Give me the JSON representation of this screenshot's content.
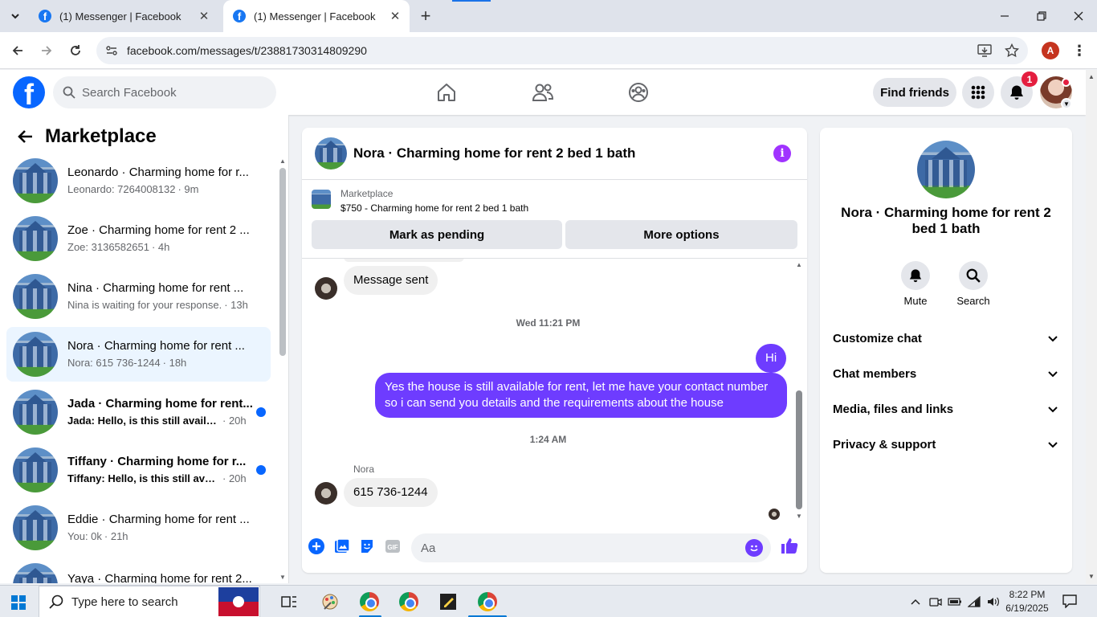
{
  "browser": {
    "tabs": [
      {
        "title": "(1) Messenger | Facebook",
        "active": false
      },
      {
        "title": "(1) Messenger | Facebook",
        "active": true
      }
    ],
    "url": "facebook.com/messages/t/23881730314809290",
    "profile_initial": "A"
  },
  "facebook": {
    "search_placeholder": "Search Facebook",
    "find_friends_label": "Find friends",
    "notification_count": "1",
    "brand_color": "#0866ff"
  },
  "sidebar": {
    "title": "Marketplace",
    "conversations": [
      {
        "name": "Leonardo · Charming home for r...",
        "preview": "Leonardo: 7264008132",
        "time": "· 9m",
        "unread": false,
        "selected": false
      },
      {
        "name": "Zoe · Charming home for rent 2 ...",
        "preview": "Zoe: 3136582651",
        "time": "· 4h",
        "unread": false,
        "selected": false
      },
      {
        "name": "Nina · Charming home for rent ...",
        "preview": "Nina is waiting for your response.",
        "time": "· 13h",
        "unread": false,
        "selected": false
      },
      {
        "name": "Nora · Charming home for rent ...",
        "preview": "Nora: 615 736-1244",
        "time": "· 18h",
        "unread": false,
        "selected": true
      },
      {
        "name": "Jada · Charming home for rent...",
        "preview": "Jada: Hello, is this still available?",
        "time": "· 20h",
        "unread": true,
        "selected": false
      },
      {
        "name": "Tiffany · Charming home for r...",
        "preview": "Tiffany: Hello, is this still availa...",
        "time": "· 20h",
        "unread": true,
        "selected": false
      },
      {
        "name": "Eddie · Charming home for rent ...",
        "preview": "You: 0k",
        "time": "· 21h",
        "unread": false,
        "selected": false
      },
      {
        "name": "Yaya · Charming home for rent 2...",
        "preview": "",
        "time": "",
        "unread": false,
        "selected": false
      }
    ]
  },
  "chat": {
    "title": "Nora · Charming home for rent 2 bed 1 bath",
    "listing_category": "Marketplace",
    "listing_title": "$750 - Charming home for rent 2 bed 1 bath",
    "mark_pending_label": "Mark as pending",
    "more_options_label": "More options",
    "messages": {
      "msg1": "Message sent",
      "ts1": "Wed 11:21 PM",
      "out1": "Hi",
      "out2": "Yes the house is still available for rent, let me have your contact number so i can send you details and the requirements about the house",
      "ts2": "1:24 AM",
      "sender": "Nora",
      "in2": "615 736-1244"
    },
    "composer_placeholder": "Aa",
    "accent_color": "#6e3cff"
  },
  "info_panel": {
    "name": "Nora · Charming home for rent 2 bed 1 bath",
    "mute_label": "Mute",
    "search_label": "Search",
    "sections": [
      "Customize chat",
      "Chat members",
      "Media, files and links",
      "Privacy & support"
    ]
  },
  "taskbar": {
    "search_placeholder": "Type here to search",
    "time": "8:22 PM",
    "date": "6/19/2025"
  }
}
